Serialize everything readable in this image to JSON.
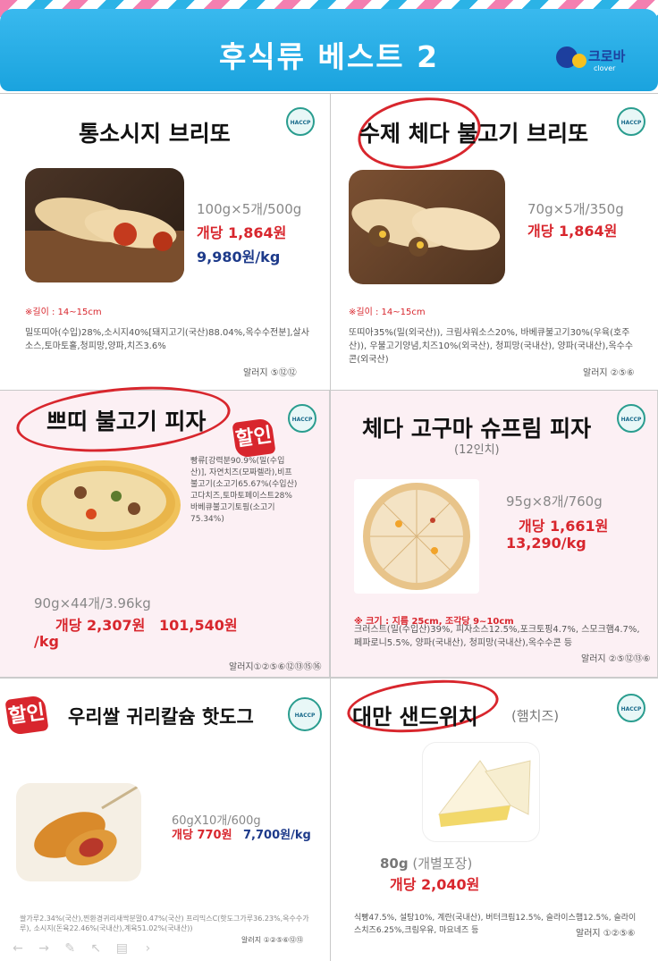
{
  "header": {
    "title": "후식류 베스트 2",
    "logo_text": "크로바",
    "logo_sub": "clover"
  },
  "haccp_label": "HACCP",
  "sale_label": "할인",
  "items": [
    {
      "title": "통소시지 브리또",
      "weight": "100g×5개/500g",
      "price": "개당 1,864원",
      "per_kg": "9,980원/kg",
      "note": "※길이 : 14~15cm",
      "ingredients": "밀또띠아(수입)28%,소시지40%[돼지고기(국산)88.04%,옥수수전분],살사소스,토마토홀,청피망,양파,치즈3.6%",
      "allergen": "알러지 ⑤⑫⑫"
    },
    {
      "title": "수제 체다 불고기 브리또",
      "weight": "70g×5개/350g",
      "price": "개당 1,864원",
      "note": "※길이 : 14~15cm",
      "ingredients": "또띠아35%(밀(외국산)), 크림샤워소스20%, 바베큐불고기30%(우육(호주산)), 우불고기양념,치즈10%(외국산), 청피망(국내산), 양파(국내산),옥수수콘(외국산)",
      "allergen": "알러지 ②⑤⑥"
    },
    {
      "title": "쁘띠 불고기 피자",
      "weight": "90g×44개/3.96kg",
      "price": "개당 2,307원",
      "per_kg_a": "101,540원",
      "per_kg_b": "/kg",
      "ingredients": "빵류[강력분90.9%(밀(수입산)], 자연치즈(모짜렐라),비프불고기(소고기65.67%(수입산)고다치즈,토마토페이스트28%바베큐불고기토핑(소고기75.34%)",
      "allergen": "알러지①②⑤⑥⑫⑬⑮⑯"
    },
    {
      "title": "체다 고구마 슈프림 피자",
      "subtitle": "(12인치)",
      "weight": "95g×8개/760g",
      "price": "개당 1,661원",
      "per_kg": "13,290/kg",
      "note": "※ 크기 : 지름 25cm, 조각당 9~10cm",
      "ingredients": "크러스트(밀(수입산)39%, 피자소스12.5%,포크토핑4.7%, 스모크햄4.7%, 페파로니5.5%, 양파(국내산), 청피망(국내산),옥수수콘 등",
      "allergen": "알러지 ②⑤⑫⑬⑥"
    },
    {
      "title": "우리쌀 귀리칼슘 핫도그",
      "weight": "60gX10개/600g",
      "price": "개당 770원",
      "per_kg": "7,700원/kg",
      "ingredients": "쌀가루2.34%(국산),찐환경귀리새싹분말0.47%(국산) 프리믹스C(핫도그가루36.23%,옥수수가루), 소시지(돈육22.46%(국내산),계육51.02%(국내산))",
      "allergen": "알러지 ①②⑤⑥⑫⑬"
    },
    {
      "title": "대만 샌드위치",
      "subtitle": "(햄치즈)",
      "weight": "80g",
      "weight_note": "(개별포장)",
      "price": "개당 2,040원",
      "ingredients": "식빵47.5%, 설탕10%, 계란(국내산), 버터크림12.5%, 슬라이스햄12.5%, 슬라이스치즈6.25%,크림우유, 마요네즈 등",
      "allergen": "알러지 ①②⑤⑥"
    }
  ],
  "toolbar": [
    "←",
    "→",
    "✎",
    "↖",
    "▤",
    "›"
  ]
}
